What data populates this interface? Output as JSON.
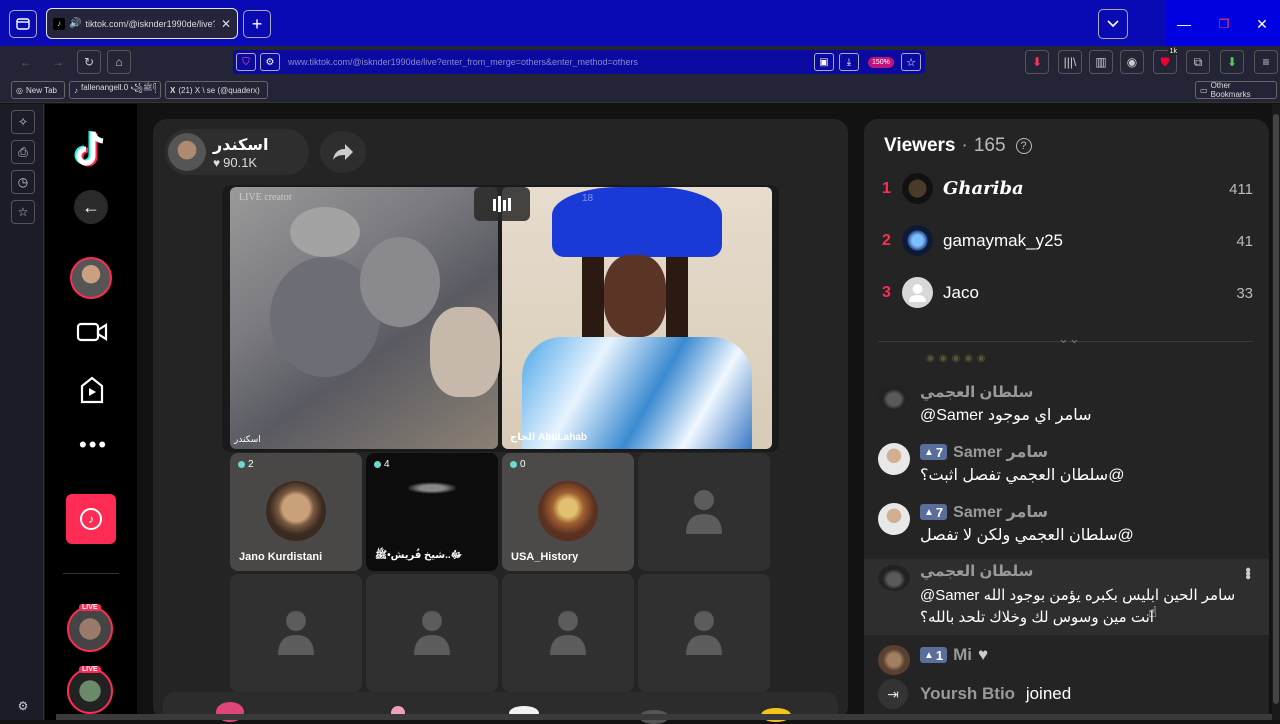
{
  "browser": {
    "tab_title": "tiktok.com/@isknder1990de/live?",
    "url": "www.tiktok.com/@isknder1990de/live?enter_from_merge=others&enter_method=others",
    "zoom": "150%",
    "badge_count": "1k",
    "bookmarks": [
      "New Tab",
      "fallenangell.0 ꧁ﷺ꧂",
      "(21) X \\ se (@quaderx)"
    ],
    "other_bookmarks": "Other Bookmarks"
  },
  "host": {
    "name": "اسكندر",
    "likes": "90.1K"
  },
  "stage": {
    "live_creator": "LIVE creator",
    "main_left_label": "اسكندر",
    "main_right_label": "الحاج AbuLahab",
    "main_right_count": "18"
  },
  "seats": [
    {
      "count": "2",
      "name": "Jano Kurdistani"
    },
    {
      "count": "4",
      "name": "ﷻ..ﺷﻴﺦ فُريش•ﷺ"
    },
    {
      "count": "0",
      "name": "USA_History"
    }
  ],
  "viewers": {
    "title": "Viewers",
    "count": "165",
    "top": [
      {
        "rank": "1",
        "name": "𝑮𝒉𝒂𝒓𝒊𝒃𝒂",
        "score": "411"
      },
      {
        "rank": "2",
        "name": "gamaymak_y25",
        "score": "41"
      },
      {
        "rank": "3",
        "name": "Jaco",
        "score": "33"
      }
    ]
  },
  "comments": [
    {
      "user": "سلطان العجمي",
      "text": "@Samer سامر اي موجود"
    },
    {
      "level": "7",
      "user": "Samer سامر",
      "text": "سلطان العجمي تفصل اثبت؟@"
    },
    {
      "level": "7",
      "user": "Samer سامر",
      "text": "سلطان العجمي ولكن لا تفصل@"
    },
    {
      "user": "سلطان العجمي",
      "text": "@Samer سامر الحين ابليس بكبره يؤمن بوجود الله",
      "text2": "انت مين وسوس لك وخلاك تلحد بالله؟"
    },
    {
      "level": "1",
      "user": "Mi"
    }
  ],
  "join": {
    "user": "Yoursh Btio",
    "action": "joined"
  },
  "colors": {
    "browser_blue": "#0a0ab4",
    "tiktok_pink": "#fe2c55",
    "badge_blue": "#5a6e9c"
  }
}
